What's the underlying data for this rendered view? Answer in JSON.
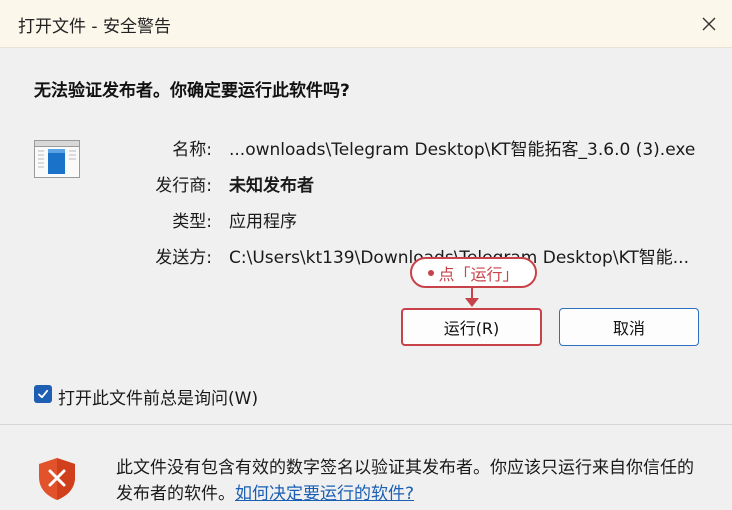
{
  "window": {
    "title": "打开文件 - 安全警告",
    "close_icon": "close-icon"
  },
  "dialog": {
    "question": "无法验证发布者。你确定要运行此软件吗?",
    "file_icon": "application-file-icon",
    "properties": [
      {
        "label": "名称:",
        "value": "...ownloads\\Telegram Desktop\\KT智能拓客_3.6.0 (3).exe",
        "bold": false
      },
      {
        "label": "发行商:",
        "value": "未知发布者",
        "bold": true
      },
      {
        "label": "类型:",
        "value": "应用程序",
        "bold": false
      },
      {
        "label": "发送方:",
        "value": "C:\\Users\\kt139\\Downloads\\Telegram Desktop\\KT智能...",
        "bold": false
      }
    ],
    "run_label": "运行(R)",
    "cancel_label": "取消",
    "checkbox_label": "打开此文件前总是询问(W)",
    "checkbox_checked": true
  },
  "annotation": {
    "callout_text": "点「运行」",
    "color": "#c8424a"
  },
  "footer": {
    "shield_icon": "shield-warning-icon",
    "warning_text": "此文件没有包含有效的数字签名以验证其发布者。你应该只运行来自你信任的发布者的软件。",
    "link_text": "如何决定要运行的软件?"
  },
  "colors": {
    "accent": "#1e5fb4",
    "link": "#1a5fb4",
    "title_bg": "#fbf7ea",
    "shield": "#e2522b"
  }
}
